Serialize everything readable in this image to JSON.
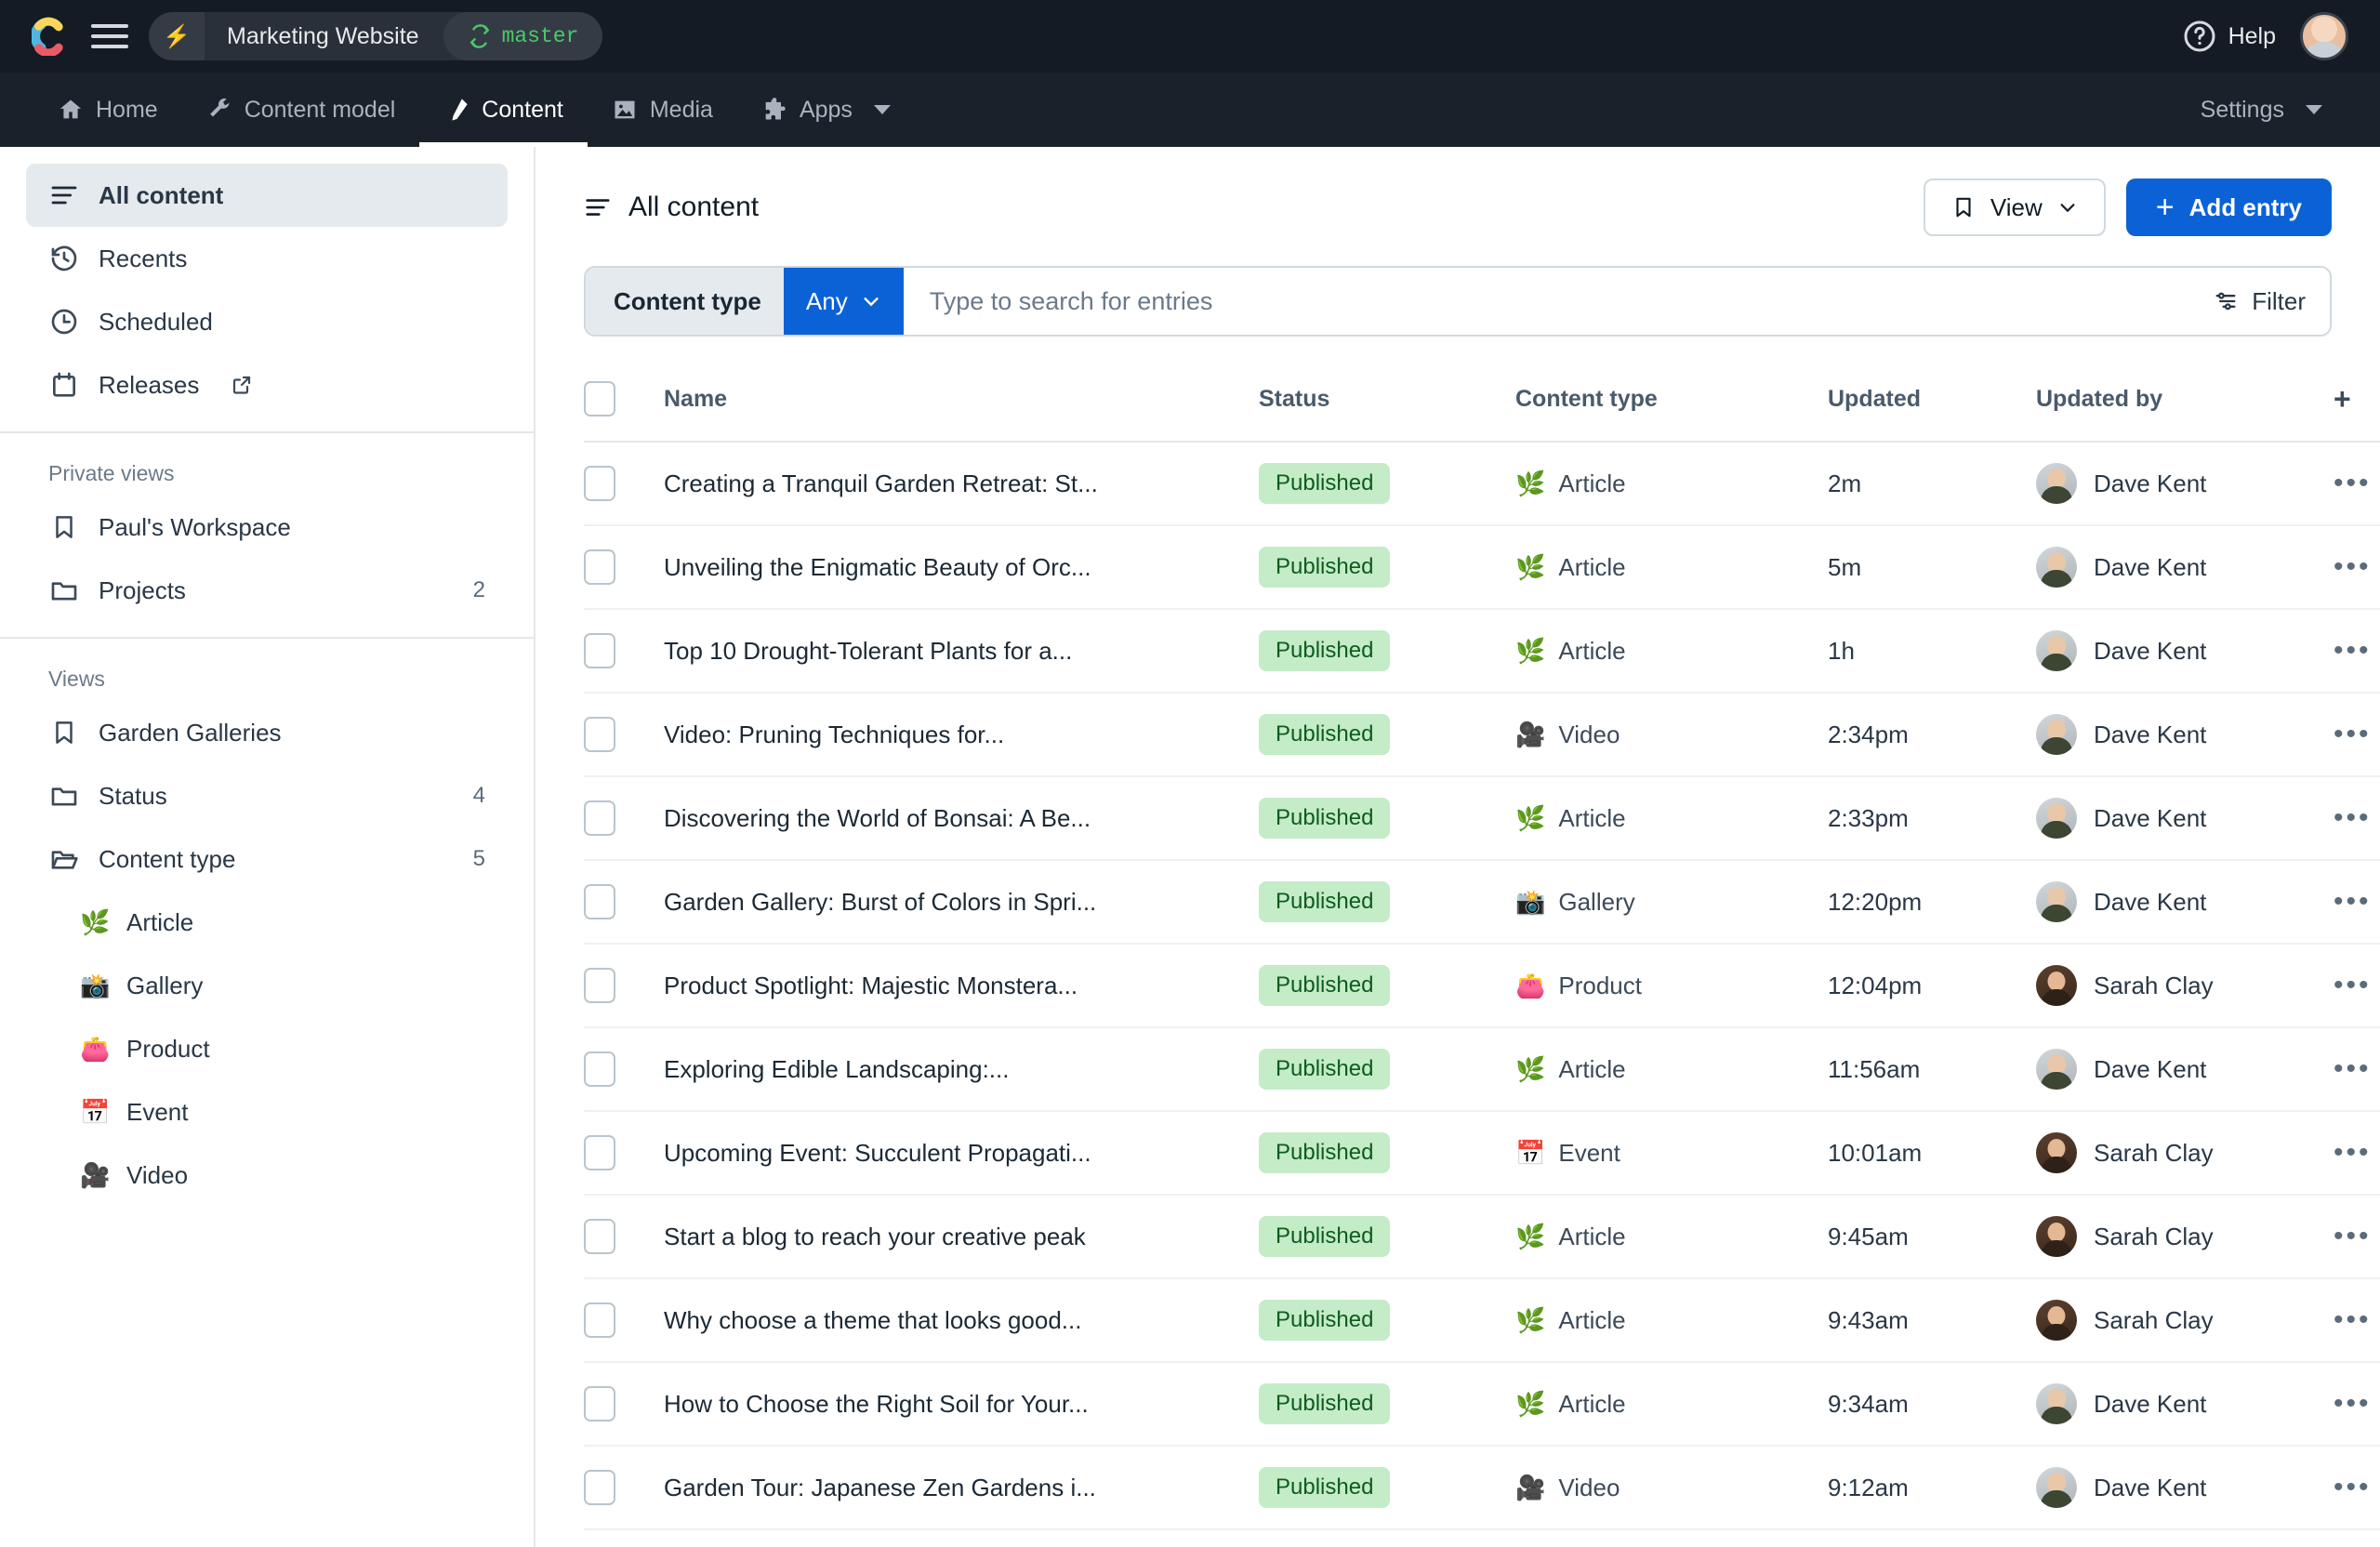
{
  "topbar": {
    "logo": "contentful-logo",
    "menu_icon": "hamburger-icon",
    "bolt_icon": "⚡",
    "space_name": "Marketing Website",
    "environment": "master",
    "environment_icon": "branch-icon",
    "help_label": "Help",
    "help_icon": "question-circle-icon",
    "avatar": "user-avatar"
  },
  "nav": {
    "items": [
      {
        "label": "Home",
        "icon": "home-icon",
        "active": false
      },
      {
        "label": "Content model",
        "icon": "wrench-icon",
        "active": false
      },
      {
        "label": "Content",
        "icon": "pen-nib-icon",
        "active": true
      },
      {
        "label": "Media",
        "icon": "image-icon",
        "active": false
      },
      {
        "label": "Apps",
        "icon": "puzzle-icon",
        "active": false,
        "caret": true
      }
    ],
    "settings_label": "Settings"
  },
  "sidebar": {
    "primary": [
      {
        "label": "All content",
        "icon": "list-icon",
        "active": true
      },
      {
        "label": "Recents",
        "icon": "history-icon",
        "active": false
      },
      {
        "label": "Scheduled",
        "icon": "clock-icon",
        "active": false
      },
      {
        "label": "Releases",
        "icon": "calendar-icon",
        "active": false,
        "external": true
      }
    ],
    "private_views_heading": "Private views",
    "private_views": [
      {
        "label": "Paul's Workspace",
        "icon": "bookmark-icon",
        "count": ""
      },
      {
        "label": "Projects",
        "icon": "folder-icon",
        "count": "2"
      }
    ],
    "views_heading": "Views",
    "views": [
      {
        "label": "Garden Galleries",
        "icon": "bookmark-icon",
        "count": ""
      },
      {
        "label": "Status",
        "icon": "folder-icon",
        "count": "4"
      },
      {
        "label": "Content type",
        "icon": "folder-open-icon",
        "count": "5"
      }
    ],
    "content_types": [
      {
        "label": "Article",
        "emoji": "🌿"
      },
      {
        "label": "Gallery",
        "emoji": "📸"
      },
      {
        "label": "Product",
        "emoji": "👛"
      },
      {
        "label": "Event",
        "emoji": "📅"
      },
      {
        "label": "Video",
        "emoji": "🎥"
      }
    ]
  },
  "main": {
    "title": "All content",
    "title_icon": "list-icon",
    "view_button": "View",
    "view_icon": "bookmark-icon",
    "add_entry_button": "Add entry",
    "add_icon": "plus-icon",
    "search": {
      "content_type_label": "Content type",
      "content_type_value": "Any",
      "placeholder": "Type to search for entries",
      "value": ""
    },
    "filter_label": "Filter",
    "filter_icon": "filter-icon",
    "columns": [
      "Name",
      "Status",
      "Content type",
      "Updated",
      "Updated by"
    ],
    "add_column_icon": "plus-icon",
    "rows": [
      {
        "name": "Creating a Tranquil Garden Retreat: St...",
        "status": "Published",
        "content_type": "Article",
        "emoji": "🌿",
        "updated": "2m",
        "updated_by": "Dave Kent",
        "avatar": "dave"
      },
      {
        "name": "Unveiling the Enigmatic Beauty of Orc...",
        "status": "Published",
        "content_type": "Article",
        "emoji": "🌿",
        "updated": "5m",
        "updated_by": "Dave Kent",
        "avatar": "dave"
      },
      {
        "name": "Top 10 Drought-Tolerant Plants for a...",
        "status": "Published",
        "content_type": "Article",
        "emoji": "🌿",
        "updated": "1h",
        "updated_by": "Dave Kent",
        "avatar": "dave"
      },
      {
        "name": "Video: Pruning Techniques for...",
        "status": "Published",
        "content_type": "Video",
        "emoji": "🎥",
        "updated": "2:34pm",
        "updated_by": "Dave Kent",
        "avatar": "dave"
      },
      {
        "name": "Discovering the World of Bonsai: A Be...",
        "status": "Published",
        "content_type": "Article",
        "emoji": "🌿",
        "updated": "2:33pm",
        "updated_by": "Dave Kent",
        "avatar": "dave"
      },
      {
        "name": "Garden Gallery: Burst of Colors in Spri...",
        "status": "Published",
        "content_type": "Gallery",
        "emoji": "📸",
        "updated": "12:20pm",
        "updated_by": "Dave Kent",
        "avatar": "dave"
      },
      {
        "name": "Product Spotlight: Majestic Monstera...",
        "status": "Published",
        "content_type": "Product",
        "emoji": "👛",
        "updated": "12:04pm",
        "updated_by": "Sarah Clay",
        "avatar": "sarah"
      },
      {
        "name": "Exploring Edible Landscaping:...",
        "status": "Published",
        "content_type": "Article",
        "emoji": "🌿",
        "updated": "11:56am",
        "updated_by": "Dave Kent",
        "avatar": "dave"
      },
      {
        "name": "Upcoming Event: Succulent Propagati...",
        "status": "Published",
        "content_type": "Event",
        "emoji": "📅",
        "updated": "10:01am",
        "updated_by": "Sarah Clay",
        "avatar": "sarah"
      },
      {
        "name": "Start a blog to reach your creative peak",
        "status": "Published",
        "content_type": "Article",
        "emoji": "🌿",
        "updated": "9:45am",
        "updated_by": "Sarah Clay",
        "avatar": "sarah"
      },
      {
        "name": "Why choose a theme that looks good...",
        "status": "Published",
        "content_type": "Article",
        "emoji": "🌿",
        "updated": "9:43am",
        "updated_by": "Sarah Clay",
        "avatar": "sarah"
      },
      {
        "name": "How to Choose the Right Soil for Your...",
        "status": "Published",
        "content_type": "Article",
        "emoji": "🌿",
        "updated": "9:34am",
        "updated_by": "Dave Kent",
        "avatar": "dave"
      },
      {
        "name": "Garden Tour: Japanese Zen Gardens i...",
        "status": "Published",
        "content_type": "Video",
        "emoji": "🎥",
        "updated": "9:12am",
        "updated_by": "Dave Kent",
        "avatar": "dave"
      }
    ]
  },
  "colors": {
    "accent": "#0b62d6",
    "topbar_bg": "#141b24",
    "navbar_bg": "#1a212b",
    "published_bg": "#c4ecc7",
    "published_text": "#0d5c1e",
    "env_green": "#4cc86a"
  }
}
